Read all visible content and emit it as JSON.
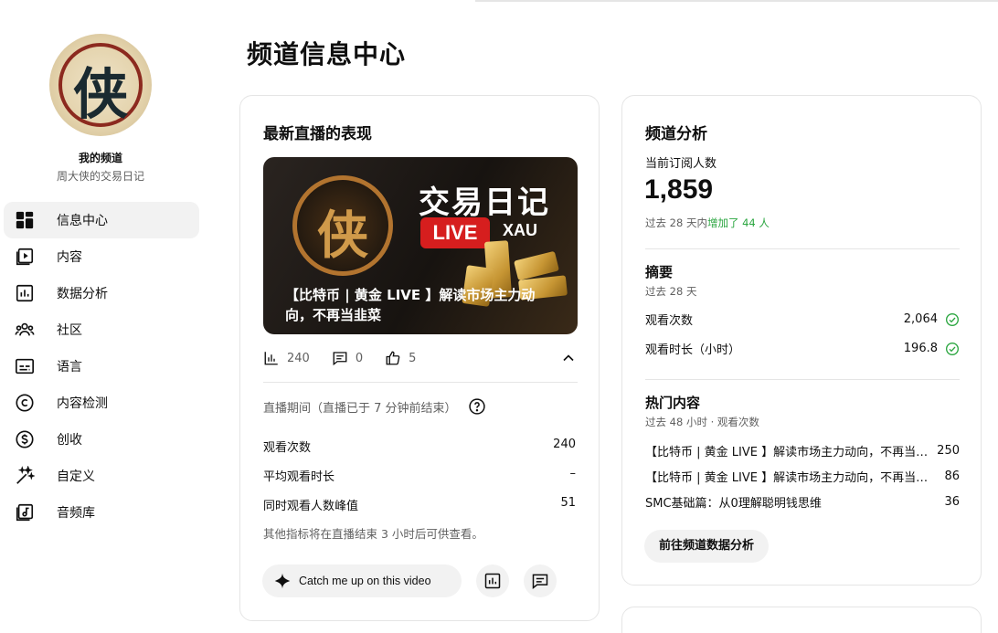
{
  "sidebar": {
    "avatar_glyph": "侠",
    "channel_name": "我的频道",
    "channel_handle": "周大侠的交易日记",
    "items": [
      {
        "label": "信息中心",
        "icon": "dashboard-icon",
        "active": true
      },
      {
        "label": "内容",
        "icon": "content-icon"
      },
      {
        "label": "数据分析",
        "icon": "analytics-icon"
      },
      {
        "label": "社区",
        "icon": "community-icon"
      },
      {
        "label": "语言",
        "icon": "subtitles-icon"
      },
      {
        "label": "内容检测",
        "icon": "copyright-icon"
      },
      {
        "label": "创收",
        "icon": "monetization-icon"
      },
      {
        "label": "自定义",
        "icon": "customization-icon"
      },
      {
        "label": "音频库",
        "icon": "audio-library-icon"
      }
    ]
  },
  "page_title": "频道信息中心",
  "live_card": {
    "title": "最新直播的表现",
    "thumbnail": {
      "emblem_glyph": "侠",
      "brand": "交易日记",
      "live_badge": "LIVE",
      "tag": "XAU",
      "caption": "【比特币 | 黄金 LIVE 】解读市场主力动向，不再当韭菜"
    },
    "stats": {
      "views": "240",
      "comments": "0",
      "likes": "5"
    },
    "live_period": "直播期间（直播已于 7 分钟前结束）",
    "metrics": [
      {
        "label": "观看次数",
        "value": "240"
      },
      {
        "label": "平均观看时长",
        "value": "–"
      },
      {
        "label": "同时观看人数峰值",
        "value": "51"
      }
    ],
    "note": "其他指标将在直播结束 3 小时后可供查看。",
    "catch_up_label": "Catch me up on this video"
  },
  "analytics_card": {
    "title": "频道分析",
    "subscribers_label": "当前订阅人数",
    "subscribers": "1,859",
    "growth_prefix": "过去 28 天内",
    "growth_value": "增加了 44 人",
    "summary_title": "摘要",
    "summary_period": "过去 28 天",
    "summary_rows": [
      {
        "label": "观看次数",
        "value": "2,064"
      },
      {
        "label": "观看时长（小时）",
        "value": "196.8"
      }
    ],
    "top_title": "热门内容",
    "top_period": "过去 48 小时 · 观看次数",
    "top_rows": [
      {
        "title": "【比特币 | 黄金 LIVE 】解读市场主力动向，不再当韭菜",
        "value": "250"
      },
      {
        "title": "【比特币 | 黄金 LIVE 】解读市场主力动向，不再当韭菜",
        "value": "86"
      },
      {
        "title": "SMC基础篇：从0理解聪明钱思维",
        "value": "36"
      }
    ],
    "button_label": "前往频道数据分析"
  },
  "colors": {
    "positive": "#2ba640",
    "live_red": "#d61e1e",
    "text_secondary": "#606060"
  }
}
